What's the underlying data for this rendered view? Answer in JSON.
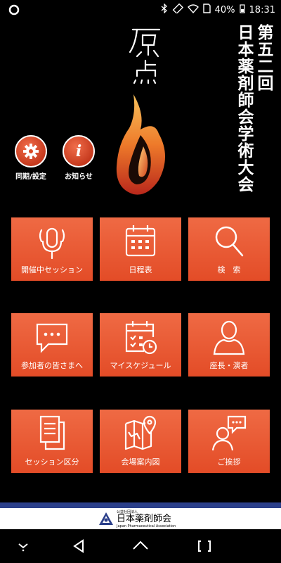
{
  "status": {
    "battery": "40%",
    "time": "18:31"
  },
  "title_columns": [
    "第五二回",
    "日本薬剤師会学術大会"
  ],
  "logo_text": "原点",
  "round_buttons": [
    {
      "label": "同期/設定",
      "icon": "gear-icon"
    },
    {
      "label": "お知らせ",
      "icon": "info-icon"
    }
  ],
  "tiles": [
    {
      "label": "開催中セッション",
      "icon": "microphone-icon"
    },
    {
      "label": "日程表",
      "icon": "calendar-icon"
    },
    {
      "label": "検　索",
      "icon": "magnifier-icon"
    },
    {
      "label": "参加者の皆さまへ",
      "icon": "chat-bubble-icon"
    },
    {
      "label": "マイスケジュール",
      "icon": "calendar-clock-icon"
    },
    {
      "label": "座長・演者",
      "icon": "person-icon"
    },
    {
      "label": "セッション区分",
      "icon": "documents-icon"
    },
    {
      "label": "会場案内図",
      "icon": "map-icon"
    },
    {
      "label": "ご挨拶",
      "icon": "greeting-icon"
    }
  ],
  "footer": {
    "org_prefix": "公益社団法人",
    "org_name": "日本薬剤師会",
    "org_en": "Japan Pharmaceutical Association"
  },
  "colors": {
    "tile": "#e85a32",
    "accent_blue": "#2b3f8a"
  }
}
